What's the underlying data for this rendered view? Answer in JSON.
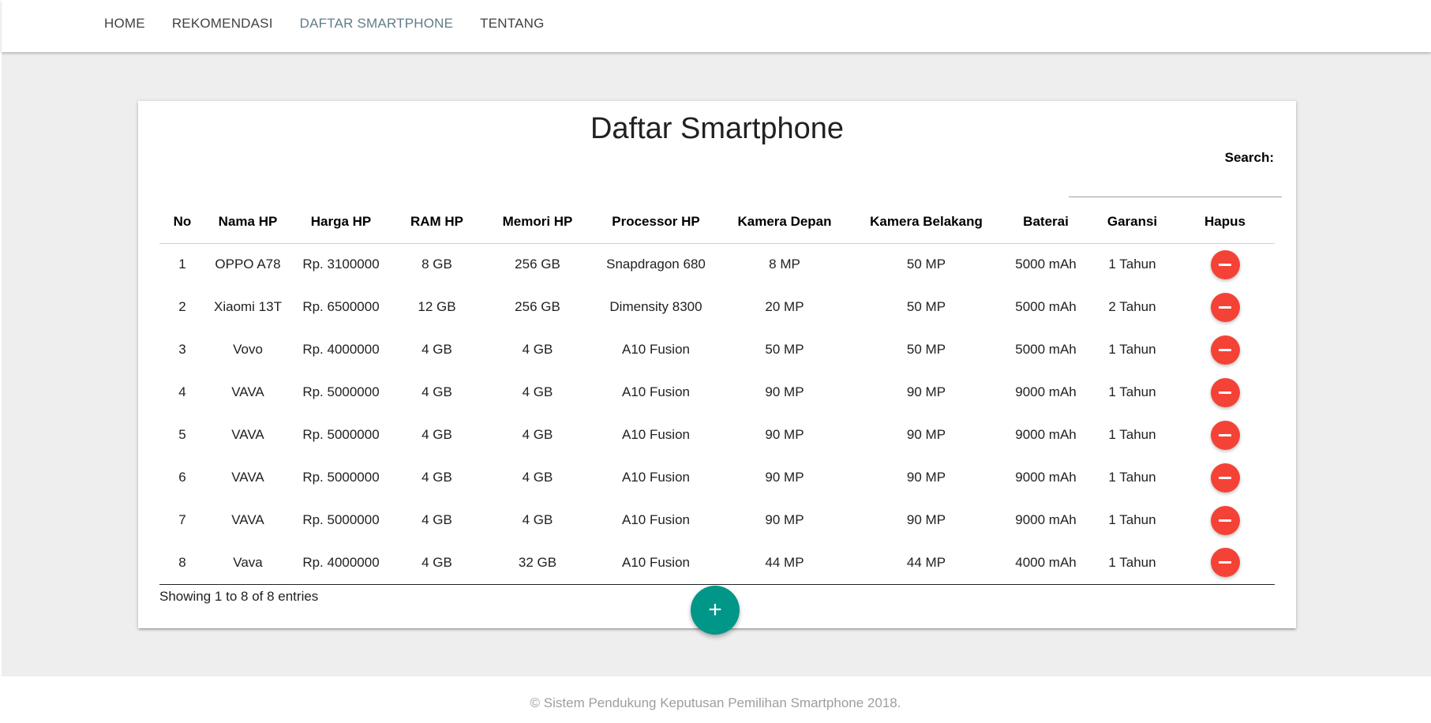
{
  "nav": {
    "items": [
      {
        "label": "HOME",
        "active": false
      },
      {
        "label": "REKOMENDASI",
        "active": false
      },
      {
        "label": "DAFTAR SMARTPHONE",
        "active": true
      },
      {
        "label": "TENTANG",
        "active": false
      }
    ],
    "active_color": "#607d8b"
  },
  "card": {
    "title": "Daftar Smartphone",
    "search_label": "Search:",
    "search_value": ""
  },
  "table": {
    "columns": [
      "No",
      "Nama HP",
      "Harga HP",
      "RAM HP",
      "Memori HP",
      "Processor HP",
      "Kamera Depan",
      "Kamera Belakang",
      "Baterai",
      "Garansi",
      "Hapus"
    ],
    "rows": [
      [
        "1",
        "OPPO A78",
        "Rp. 3100000",
        "8 GB",
        "256 GB",
        "Snapdragon 680",
        "8 MP",
        "50 MP",
        "5000 mAh",
        "1 Tahun"
      ],
      [
        "2",
        "Xiaomi 13T",
        "Rp. 6500000",
        "12 GB",
        "256 GB",
        "Dimensity 8300",
        "20 MP",
        "50 MP",
        "5000 mAh",
        "2 Tahun"
      ],
      [
        "3",
        "Vovo",
        "Rp. 4000000",
        "4 GB",
        "4 GB",
        "A10 Fusion",
        "50 MP",
        "50 MP",
        "5000 mAh",
        "1 Tahun"
      ],
      [
        "4",
        "VAVA",
        "Rp. 5000000",
        "4 GB",
        "4 GB",
        "A10 Fusion",
        "90 MP",
        "90 MP",
        "9000 mAh",
        "1 Tahun"
      ],
      [
        "5",
        "VAVA",
        "Rp. 5000000",
        "4 GB",
        "4 GB",
        "A10 Fusion",
        "90 MP",
        "90 MP",
        "9000 mAh",
        "1 Tahun"
      ],
      [
        "6",
        "VAVA",
        "Rp. 5000000",
        "4 GB",
        "4 GB",
        "A10 Fusion",
        "90 MP",
        "90 MP",
        "9000 mAh",
        "1 Tahun"
      ],
      [
        "7",
        "VAVA",
        "Rp. 5000000",
        "4 GB",
        "4 GB",
        "A10 Fusion",
        "90 MP",
        "90 MP",
        "9000 mAh",
        "1 Tahun"
      ],
      [
        "8",
        "Vava",
        "Rp. 4000000",
        "4 GB",
        "32 GB",
        "A10 Fusion",
        "44 MP",
        "44 MP",
        "4000 mAh",
        "1 Tahun"
      ]
    ],
    "delete_icon": "minus-icon",
    "delete_color": "#f44336",
    "info": "Showing 1 to 8 of 8 entries"
  },
  "fab": {
    "icon": "plus-icon",
    "glyph": "+",
    "color": "#009688"
  },
  "footer": {
    "text": "© Sistem Pendukung Keputusan Pemilihan Smartphone 2018."
  }
}
